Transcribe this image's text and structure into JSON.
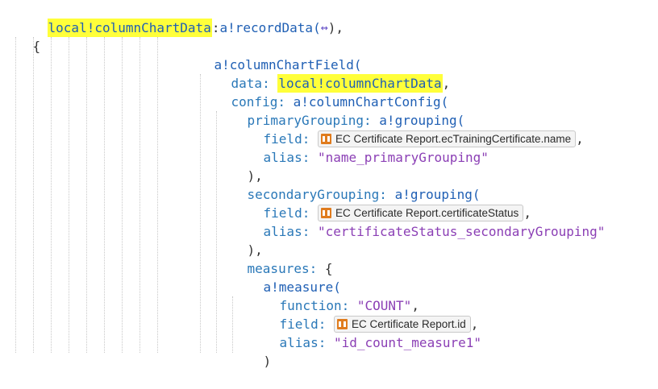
{
  "code": {
    "line1": {
      "var": "local!columnChartData",
      "sep": ":",
      "fn": "a!recordData(",
      "arrow": "↔",
      "close": "),"
    },
    "line2": {
      "brace": "{"
    },
    "line3": {
      "fn": "a!columnChartField("
    },
    "line4": {
      "key": "data:",
      "var": "local!columnChartData",
      "close": ","
    },
    "line5": {
      "key": "config:",
      "fn": "a!columnChartConfig("
    },
    "line6": {
      "key": "primaryGrouping:",
      "fn": "a!grouping("
    },
    "line7": {
      "key": "field:",
      "chip": "EC Certificate Report.ecTrainingCertificate.name",
      "close": ","
    },
    "line8": {
      "key": "alias:",
      "str": "\"name_primaryGrouping\""
    },
    "line9": {
      "text": "),"
    },
    "line10": {
      "key": "secondaryGrouping:",
      "fn": "a!grouping("
    },
    "line11": {
      "key": "field:",
      "chip": "EC Certificate Report.certificateStatus",
      "close": ","
    },
    "line12": {
      "key": "alias:",
      "str": "\"certificateStatus_secondaryGrouping\""
    },
    "line13": {
      "text": "),"
    },
    "line14": {
      "key": "measures:",
      "brace": "{"
    },
    "line15": {
      "fn": "a!measure("
    },
    "line16": {
      "key": "function:",
      "str": "\"COUNT\"",
      "close": ","
    },
    "line17": {
      "key": "field:",
      "chip": "EC Certificate Report.id",
      "close": ","
    },
    "line18": {
      "key": "alias:",
      "str": "\"id_count_measure1\""
    },
    "line19": {
      "text": ")"
    }
  },
  "icons": {
    "record_type": "record-type-icon"
  },
  "colors": {
    "highlight": "#ffff3a",
    "function": "#1f5fb4",
    "key": "#2a78b8",
    "string": "#8b3fb5",
    "record_icon": "#e07c1e"
  }
}
